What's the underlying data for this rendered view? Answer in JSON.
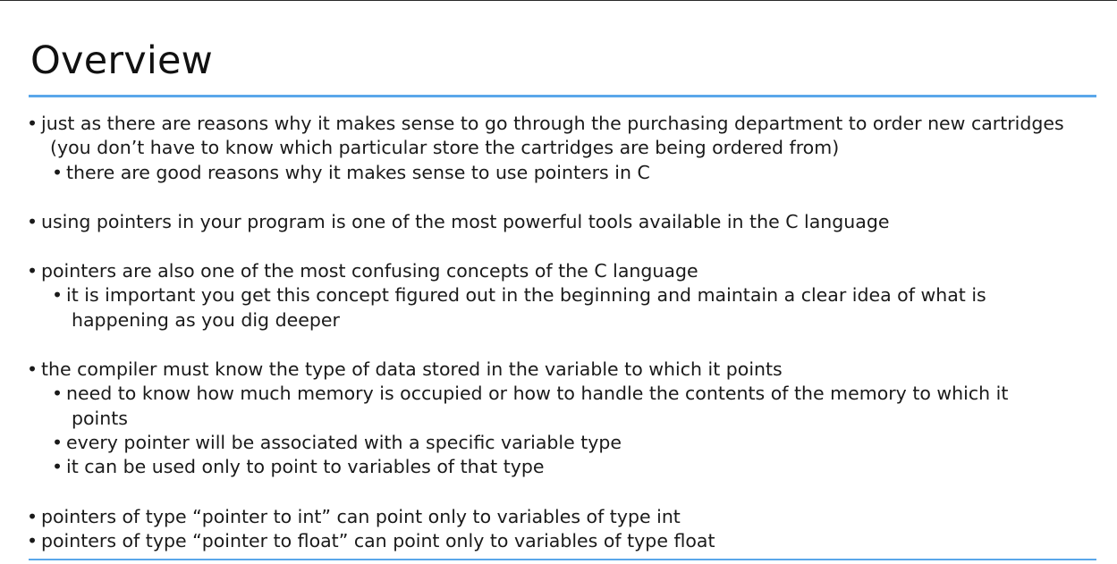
{
  "slide": {
    "title": "Overview"
  },
  "lines": [
    {
      "bullet": "•",
      "text": "just as there are reasons why it makes sense to go through the purchasing department to order new cartridges"
    },
    {
      "text": "(you don’t have to know which particular store the cartridges are being ordered from)"
    },
    {
      "bullet": "•",
      "text": "there are good reasons why it makes sense to use pointers in C"
    },
    {
      "bullet": "•",
      "text": "using pointers in your program is one of the most powerful tools available in the C language"
    },
    {
      "bullet": "•",
      "text": "pointers are also one of the most confusing concepts of the C language"
    },
    {
      "bullet": "•",
      "text": "it is important you get this concept figured out in the beginning and maintain a clear idea of what is"
    },
    {
      "text": "happening as you dig deeper"
    },
    {
      "bullet": "•",
      "text": "the compiler must know the type of data stored in the variable to which it points"
    },
    {
      "bullet": "•",
      "text": "need to know how much memory is occupied or how to handle the contents of the memory to which it"
    },
    {
      "text": "points"
    },
    {
      "bullet": "•",
      "text": "every pointer will be associated with a specific variable type"
    },
    {
      "bullet": "•",
      "text": "it can be used only to point to variables of that type"
    },
    {
      "bullet": "•",
      "text": "pointers of type “pointer to int” can point only to variables of type int"
    },
    {
      "bullet": "•",
      "text": "pointers of type “pointer to float” can point only to variables of type float"
    }
  ],
  "colors": {
    "accent_rule": "#5aa7ea",
    "text": "#1a1a1a"
  }
}
